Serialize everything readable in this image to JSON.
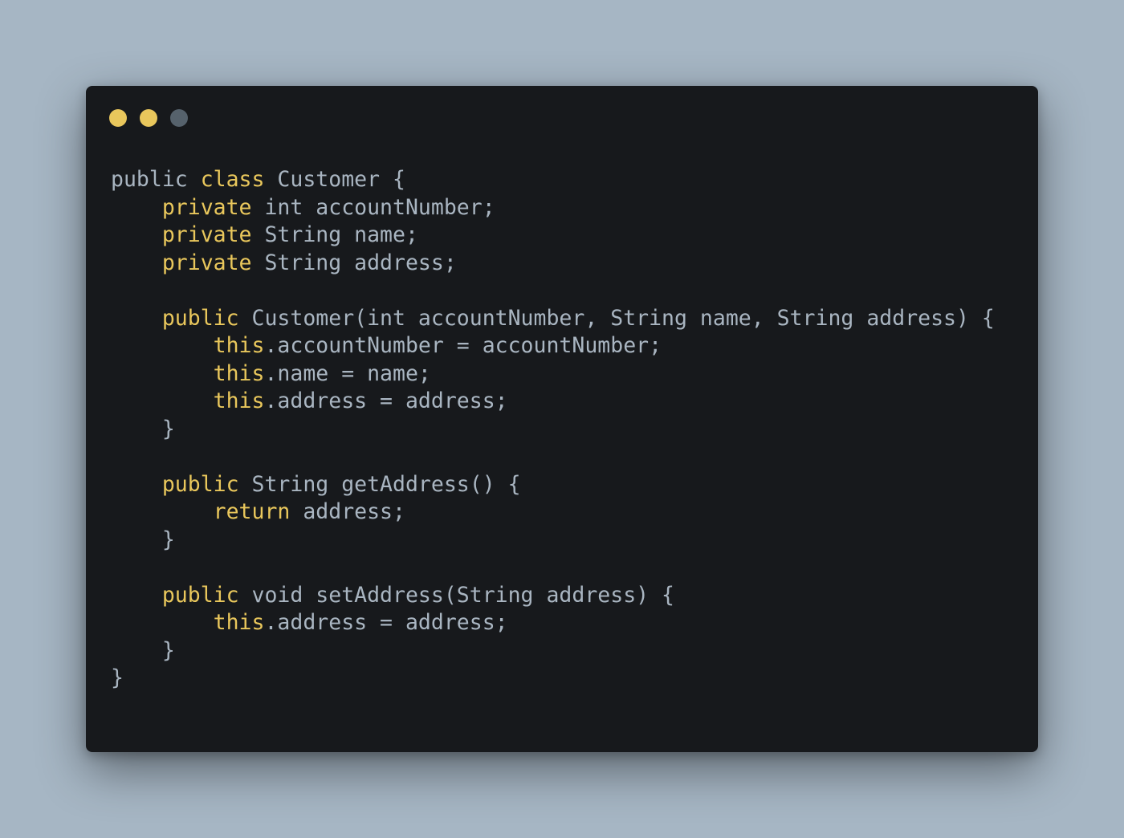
{
  "window": {
    "dots": [
      {
        "name": "close-dot",
        "color": "#e9c75c"
      },
      {
        "name": "minimize-dot",
        "color": "#e9c75c"
      },
      {
        "name": "maximize-dot",
        "color": "#56626c"
      }
    ]
  },
  "colors": {
    "background": "#a6b6c4",
    "panel": "#17191c",
    "keyword": "#e9c75c",
    "text": "#a9b5c1"
  },
  "code": {
    "language": "java",
    "lines": [
      [
        {
          "t": "public ",
          "k": "plain"
        },
        {
          "t": "class",
          "k": "kw"
        },
        {
          "t": " Customer {",
          "k": "plain"
        }
      ],
      [
        {
          "t": "    ",
          "k": "plain"
        },
        {
          "t": "private",
          "k": "kw"
        },
        {
          "t": " int accountNumber;",
          "k": "plain"
        }
      ],
      [
        {
          "t": "    ",
          "k": "plain"
        },
        {
          "t": "private",
          "k": "kw"
        },
        {
          "t": " String name;",
          "k": "plain"
        }
      ],
      [
        {
          "t": "    ",
          "k": "plain"
        },
        {
          "t": "private",
          "k": "kw"
        },
        {
          "t": " String address;",
          "k": "plain"
        }
      ],
      [],
      [
        {
          "t": "    ",
          "k": "plain"
        },
        {
          "t": "public",
          "k": "kw"
        },
        {
          "t": " Customer(int accountNumber, String name, String address) {",
          "k": "plain"
        }
      ],
      [
        {
          "t": "        ",
          "k": "plain"
        },
        {
          "t": "this",
          "k": "kw"
        },
        {
          "t": ".accountNumber = accountNumber;",
          "k": "plain"
        }
      ],
      [
        {
          "t": "        ",
          "k": "plain"
        },
        {
          "t": "this",
          "k": "kw"
        },
        {
          "t": ".name = name;",
          "k": "plain"
        }
      ],
      [
        {
          "t": "        ",
          "k": "plain"
        },
        {
          "t": "this",
          "k": "kw"
        },
        {
          "t": ".address = address;",
          "k": "plain"
        }
      ],
      [
        {
          "t": "    }",
          "k": "plain"
        }
      ],
      [],
      [
        {
          "t": "    ",
          "k": "plain"
        },
        {
          "t": "public",
          "k": "kw"
        },
        {
          "t": " String getAddress() {",
          "k": "plain"
        }
      ],
      [
        {
          "t": "        ",
          "k": "plain"
        },
        {
          "t": "return",
          "k": "kw"
        },
        {
          "t": " address;",
          "k": "plain"
        }
      ],
      [
        {
          "t": "    }",
          "k": "plain"
        }
      ],
      [],
      [
        {
          "t": "    ",
          "k": "plain"
        },
        {
          "t": "public",
          "k": "kw"
        },
        {
          "t": " void setAddress(String address) {",
          "k": "plain"
        }
      ],
      [
        {
          "t": "        ",
          "k": "plain"
        },
        {
          "t": "this",
          "k": "kw"
        },
        {
          "t": ".address = address;",
          "k": "plain"
        }
      ],
      [
        {
          "t": "    }",
          "k": "plain"
        }
      ],
      [
        {
          "t": "}",
          "k": "plain"
        }
      ]
    ]
  }
}
